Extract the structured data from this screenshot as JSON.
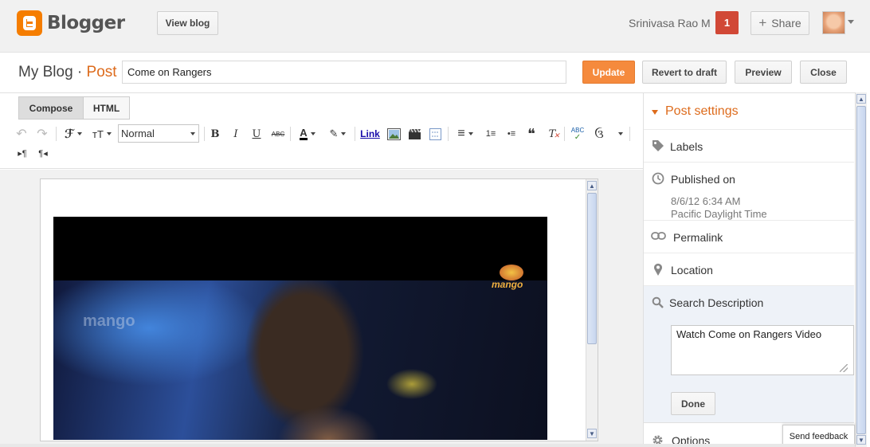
{
  "header": {
    "app_name": "Blogger",
    "view_blog_label": "View blog",
    "user_name": "Srinivasa Rao M",
    "notification_count": "1",
    "share_label": "Share",
    "share_plus": "+"
  },
  "post_bar": {
    "blog_name": "My Blog",
    "separator": "·",
    "section": "Post",
    "title_value": "Come on Rangers",
    "update_label": "Update",
    "revert_label": "Revert to draft",
    "preview_label": "Preview",
    "close_label": "Close"
  },
  "editor": {
    "mode_tabs": [
      {
        "label": "Compose",
        "active": true
      },
      {
        "label": "HTML",
        "active": false
      }
    ],
    "toolbar": {
      "undo": "↶",
      "redo": "↷",
      "font_family": "ℱ",
      "font_size_icon": "тT",
      "paragraph_style": "Normal",
      "bold": "B",
      "italic": "I",
      "underline": "U",
      "strikethrough": "ABC",
      "text_color": "A",
      "highlight": "✎",
      "link": "Link",
      "video": "🎬",
      "align": "≡",
      "numbered_list": "1≡",
      "bullet_list": "•≡",
      "quote": "❝",
      "remove_format": "T",
      "spellcheck": "ABC",
      "input_tools": "ઉ",
      "ltr": "▸¶",
      "rtl": "¶◂"
    },
    "image_watermark": "mango",
    "image_logo_text": "mango"
  },
  "sidebar": {
    "title": "Post settings",
    "labels_label": "Labels",
    "published_label": "Published on",
    "published_date": "8/6/12 6:34 AM",
    "published_tz": "Pacific Daylight Time",
    "permalink_label": "Permalink",
    "location_label": "Location",
    "search_desc_label": "Search Description",
    "search_desc_value": "Watch Come on Rangers Video",
    "done_label": "Done",
    "options_label": "Options",
    "feedback_label": "Send feedback"
  },
  "colors": {
    "accent": "#dd6b1c",
    "update_button": "#f58a3d",
    "notification": "#d14836",
    "blogger_logo": "#f57d00"
  },
  "icons": {
    "labels": "tag-icon",
    "published": "clock-icon",
    "permalink": "link-icon",
    "location": "pin-icon",
    "search_description": "search-icon",
    "options": "gear-icon"
  }
}
